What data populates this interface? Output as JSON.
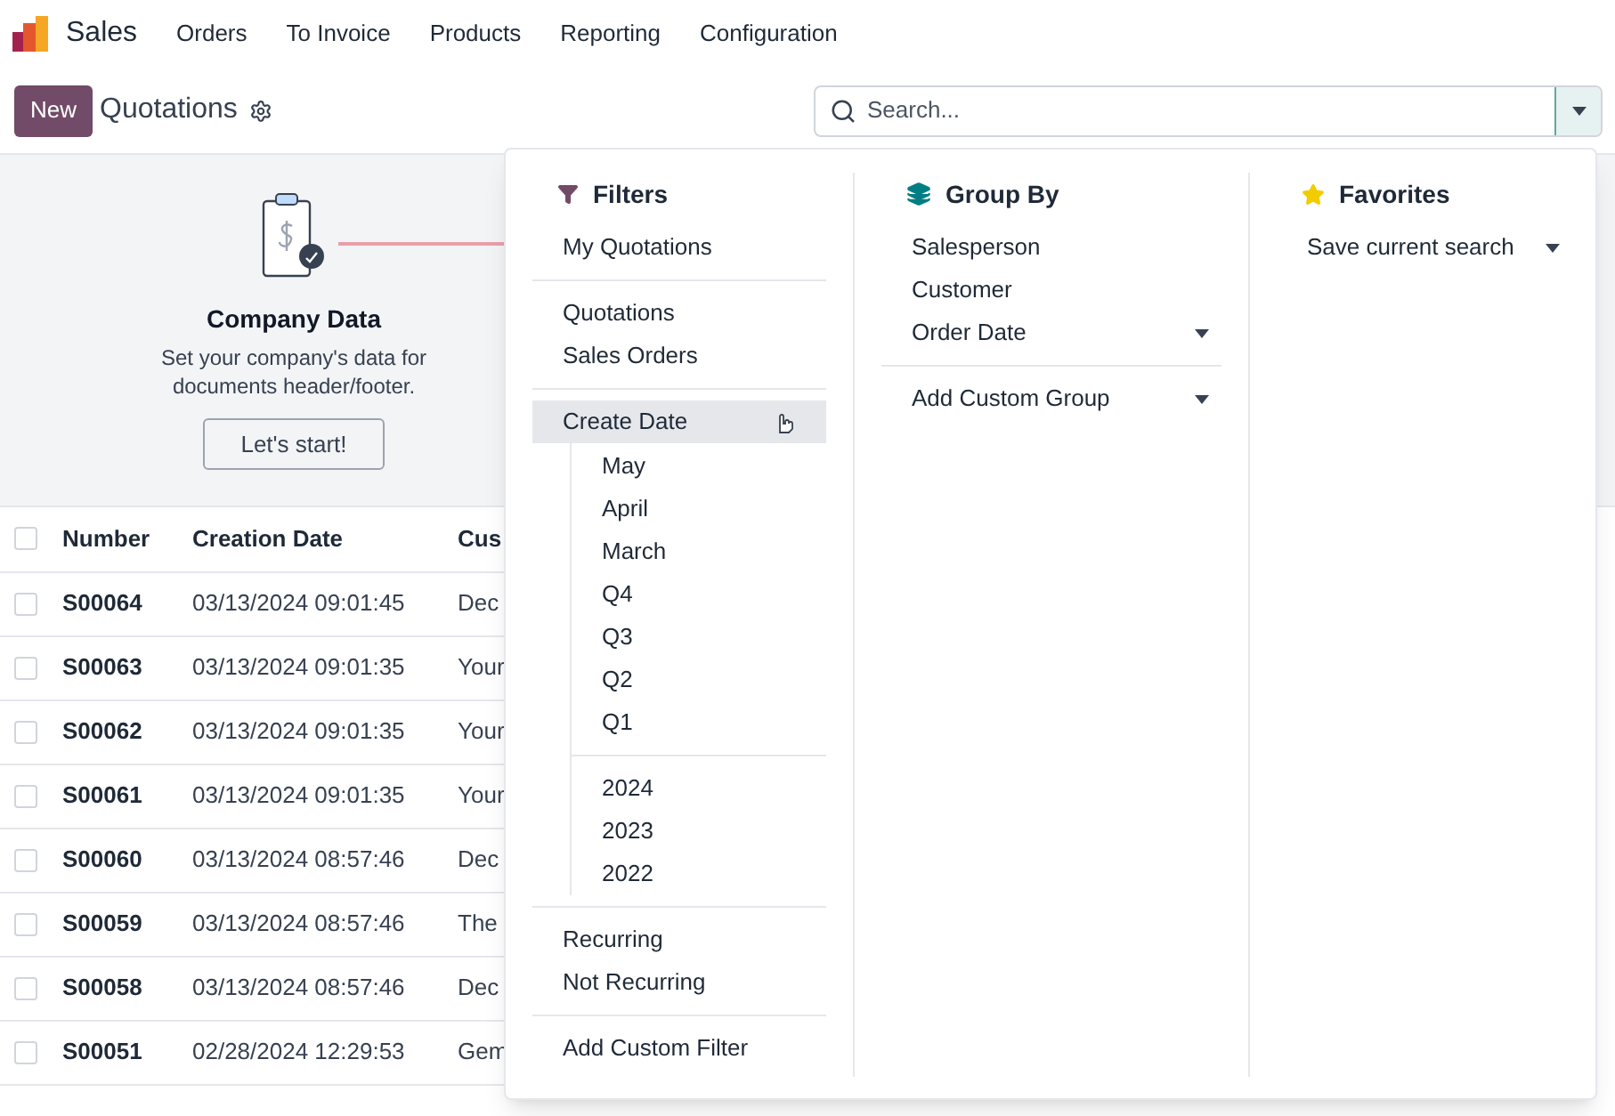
{
  "app": {
    "name": "Sales"
  },
  "menu": [
    "Orders",
    "To Invoice",
    "Products",
    "Reporting",
    "Configuration"
  ],
  "control_panel": {
    "new_button": "New",
    "title": "Quotations",
    "search": {
      "placeholder": "Search..."
    }
  },
  "banner": {
    "title": "Company Data",
    "text": "Set your company's data for documents header/footer.",
    "button": "Let's start!"
  },
  "table": {
    "select_all": {
      "checked": false
    },
    "columns": [
      "Number",
      "Creation Date",
      "Cus"
    ],
    "rows": [
      {
        "checked": false,
        "cells": [
          "S00064",
          "03/13/2024 09:01:45",
          "Dec"
        ]
      },
      {
        "checked": false,
        "cells": [
          "S00063",
          "03/13/2024 09:01:35",
          "Your"
        ]
      },
      {
        "checked": false,
        "cells": [
          "S00062",
          "03/13/2024 09:01:35",
          "Your"
        ]
      },
      {
        "checked": false,
        "cells": [
          "S00061",
          "03/13/2024 09:01:35",
          "Your"
        ]
      },
      {
        "checked": false,
        "cells": [
          "S00060",
          "03/13/2024 08:57:46",
          "Dec"
        ]
      },
      {
        "checked": false,
        "cells": [
          "S00059",
          "03/13/2024 08:57:46",
          "The"
        ]
      },
      {
        "checked": false,
        "cells": [
          "S00058",
          "03/13/2024 08:57:46",
          "Dec"
        ]
      },
      {
        "checked": false,
        "cells": [
          "S00051",
          "02/28/2024 12:29:53",
          "Gem"
        ]
      }
    ]
  },
  "dropdown": {
    "filters": {
      "title": "Filters",
      "sections": [
        [
          {
            "label": "My Quotations",
            "hovered": false
          }
        ],
        [
          {
            "label": "Quotations",
            "hovered": false
          },
          {
            "label": "Sales Orders",
            "hovered": false
          }
        ],
        [
          {
            "label": "Create Date",
            "hovered": true,
            "child_sections": [
              [
                "May",
                "April",
                "March",
                "Q4",
                "Q3",
                "Q2",
                "Q1"
              ],
              [
                "2024",
                "2023",
                "2022"
              ]
            ]
          }
        ],
        [
          {
            "label": "Recurring",
            "hovered": false
          },
          {
            "label": "Not Recurring",
            "hovered": false
          }
        ],
        [
          {
            "label": "Add Custom Filter",
            "hovered": false
          }
        ]
      ]
    },
    "group_by": {
      "title": "Group By",
      "sections": [
        [
          {
            "label": "Salesperson",
            "caret": false
          },
          {
            "label": "Customer",
            "caret": false
          },
          {
            "label": "Order Date",
            "caret": true
          }
        ],
        [
          {
            "label": "Add Custom Group",
            "caret": true
          }
        ]
      ]
    },
    "favorites": {
      "title": "Favorites",
      "sections": [
        [
          {
            "label": "Save current search",
            "caret": true
          }
        ]
      ]
    }
  }
}
